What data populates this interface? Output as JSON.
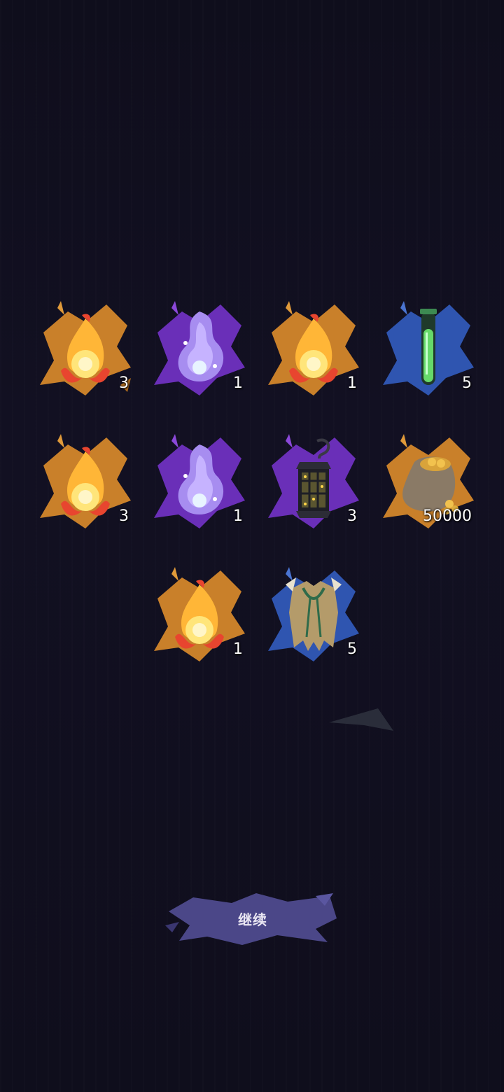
{
  "rewards": [
    {
      "item": "fire-orb",
      "count": "3"
    },
    {
      "item": "spirit-wisp",
      "count": "1"
    },
    {
      "item": "fire-orb",
      "count": "1"
    },
    {
      "item": "green-vial",
      "count": "5"
    },
    {
      "item": "fire-orb",
      "count": "3"
    },
    {
      "item": "spirit-wisp",
      "count": "1"
    },
    {
      "item": "iron-lantern",
      "count": "3"
    },
    {
      "item": "gold-coin-sack",
      "count": "50000"
    },
    {
      "item": "fire-orb",
      "count": "1"
    },
    {
      "item": "tattered-cloak",
      "count": "5"
    }
  ],
  "continue_button": {
    "label": "继续"
  },
  "colors": {
    "background": "#111020",
    "orange_rarity": "#c9802a",
    "purple_rarity": "#6a2fb8",
    "blue_rarity": "#2f55b0",
    "button": "#4b4788"
  }
}
